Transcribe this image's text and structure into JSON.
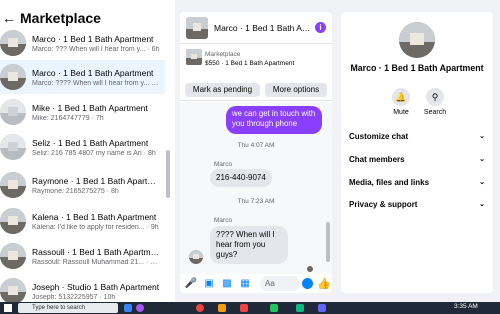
{
  "left_panel": {
    "back_icon": "left-arrow-icon",
    "title": "Marketplace",
    "conversations": [
      {
        "name": "Marco · 1 Bed 1 Bath Apartment",
        "preview": "Marco: ??? When will I hear from y... · 6h"
      },
      {
        "name": "Marco · 1 Bed 1 Bath Apartment",
        "preview": "Marco: ???? When will I hear from y... · 6h"
      },
      {
        "name": "Mike · 1 Bed 1 Bath Apartment",
        "preview": "Mike: 2164747779 · 7h"
      },
      {
        "name": "Seliz · 1 Bed 1 Bath Apartment",
        "preview": "Seliz: 216 785 4807 my name is Ari · 8h"
      },
      {
        "name": "Raymone · 1 Bed 1 Bath Apartme...",
        "preview": "Raymone: 2165275275 · 8h"
      },
      {
        "name": "Kalena · 1 Bed 1 Bath Apartment",
        "preview": "Kalena: I'd like to apply for residen... · 9h"
      },
      {
        "name": "Rassoull · 1 Bed 1 Bath Apartment",
        "preview": "Rassoull: Rassoull Muhammad 21... · 12h"
      },
      {
        "name": "Joseph · Studio 1 Bath Apartment",
        "preview": "Joseph: 5132225957 · 10h"
      }
    ]
  },
  "chat": {
    "title": "Marco · 1 Bed 1 Bath Apartment",
    "info_icon": "info-icon",
    "listing_label": "Marketplace",
    "listing_price": "$550 · 1 Bed 1 Bath Apartment",
    "mark_pending_label": "Mark as pending",
    "more_options_label": "More options",
    "outgoing_message": "we can get in touch with you through phone",
    "timestamp_1": "Thu 4:07 AM",
    "sender_1": "Marco",
    "message_1": "216-440-9074",
    "timestamp_2": "Thu 7:23 AM",
    "sender_2": "Marco",
    "message_2": "???? When will I hear from you guys?",
    "composer_placeholder": "Aa"
  },
  "details": {
    "name": "Marco · 1 Bed 1 Bath Apartment",
    "mute_label": "Mute",
    "search_label": "Search",
    "sections": [
      "Customize chat",
      "Chat members",
      "Media, files and links",
      "Privacy & support"
    ]
  },
  "taskbar": {
    "search_placeholder": "Type here to search",
    "time": "3:35 AM"
  },
  "colors": {
    "accent": "#8a3ffc",
    "messenger_blue": "#0084ff"
  }
}
